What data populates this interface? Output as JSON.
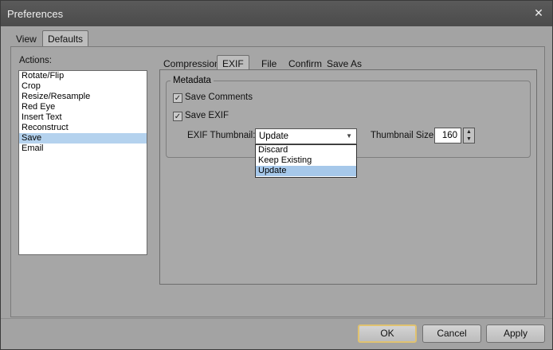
{
  "window": {
    "title": "Preferences",
    "close_glyph": "✕"
  },
  "top_tabs": [
    {
      "label": "View"
    },
    {
      "label": "Defaults",
      "active": true
    }
  ],
  "actions": {
    "label": "Actions:",
    "items": [
      "Rotate/Flip",
      "Crop",
      "Resize/Resample",
      "Red Eye",
      "Insert Text",
      "Reconstruct",
      "Save",
      "Email"
    ],
    "selected": "Save"
  },
  "sub_tabs": [
    {
      "label": "Compression"
    },
    {
      "label": "EXIF",
      "active": true
    },
    {
      "label": "File"
    },
    {
      "label": "Confirm"
    },
    {
      "label": "Save As"
    }
  ],
  "metadata": {
    "group_title": "Metadata",
    "save_comments": {
      "label": "Save Comments",
      "checked": true
    },
    "save_exif": {
      "label": "Save EXIF",
      "checked": true
    },
    "exif_thumbnail": {
      "label": "EXIF Thumbnail:",
      "value": "Update",
      "options": [
        "Discard",
        "Keep Existing",
        "Update"
      ],
      "highlighted": "Update"
    },
    "thumbnail_size": {
      "label": "Thumbnail Size:",
      "value": "160"
    },
    "check_glyph": "✓",
    "spin_up": "▲",
    "spin_down": "▼",
    "combo_arrow": "▼"
  },
  "buttons": {
    "ok": "OK",
    "cancel": "Cancel",
    "apply": "Apply"
  }
}
